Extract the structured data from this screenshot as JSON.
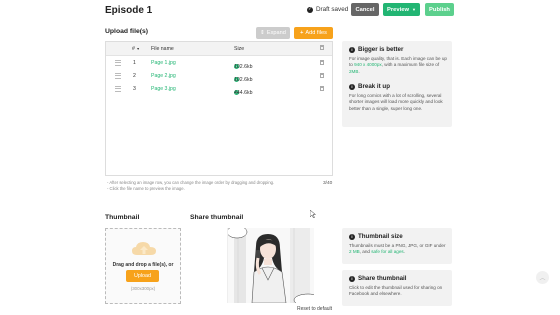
{
  "header": {
    "title": "Episode 1",
    "draft_status": "Draft saved",
    "cancel_label": "Cancel",
    "preview_label": "Preview",
    "publish_label": "Publish"
  },
  "upload": {
    "section_title": "Upload file(s)",
    "expand_label": "Expand",
    "add_files_label": "Add files",
    "columns": {
      "num": "#",
      "name": "File name",
      "size": "Size"
    },
    "files": [
      {
        "num": "1",
        "name": "Page 1.jpg",
        "size": "102.6kb"
      },
      {
        "num": "2",
        "name": "Page 2.jpg",
        "size": "102.6kb"
      },
      {
        "num": "3",
        "name": "Page 3.jpg",
        "size": "444.6kb"
      }
    ],
    "note1": "- After selecting an image row, you can change the image order by dragging and dropping.",
    "note2": "- Click the file name to preview the image.",
    "count": "3/40"
  },
  "tips": {
    "bigger_title": "Bigger is better",
    "bigger_pre": "For image quality, that is. Each image can be up to ",
    "bigger_dims": "940 x 4000px",
    "bigger_mid": ", with a maximum file size of ",
    "bigger_size": "2MB",
    "bigger_end": ".",
    "break_title": "Break it up",
    "break_text": "For long comics with a lot of scrolling, several shorter images will load more quickly and look better than a single, super long one."
  },
  "thumbnail": {
    "section_title": "Thumbnail",
    "drop_text": "Drag and drop a file(s), or",
    "upload_label": "Upload",
    "dims": "(300x300px)"
  },
  "share": {
    "section_title": "Share thumbnail",
    "reset_label": "Reset to default"
  },
  "thumb_info": {
    "size_title": "Thumbnail size",
    "size_pre": "Thumbnails must be a PNG, JPG, or GIF under ",
    "size_mb": "2 MB",
    "size_mid": ", and ",
    "size_safe": "safe for all ages",
    "size_end": ".",
    "share_title": "Share thumbnail",
    "share_text": "Click to edit the thumbnail used for sharing on Facebook and elsewhere."
  },
  "colors": {
    "accent": "#22b573",
    "orange": "#f7a21b",
    "cancel": "#666666"
  },
  "icons": [
    "check-circle-icon",
    "chevron-down-icon",
    "expand-icon",
    "plus-icon",
    "trash-icon",
    "drag-handle-icon",
    "info-icon",
    "cloud-upload-icon",
    "arrow-up-icon"
  ]
}
